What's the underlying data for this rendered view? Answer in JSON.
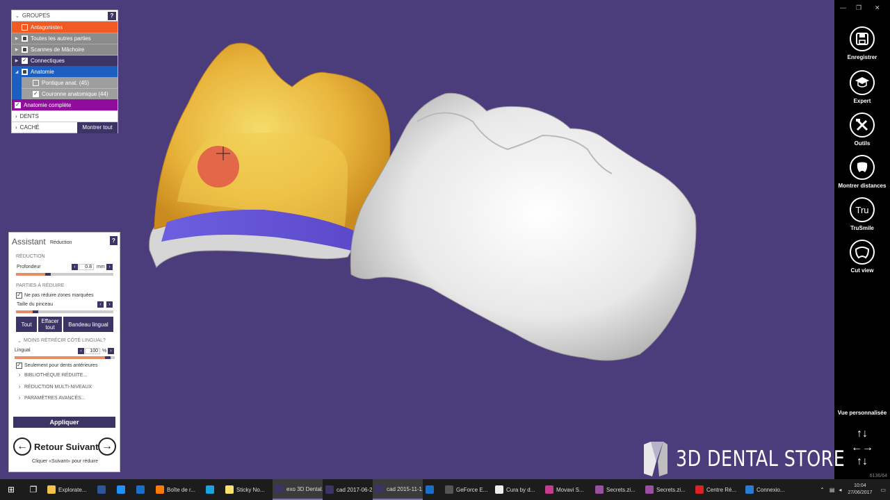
{
  "groups": {
    "header": "GROUPES",
    "help": "?",
    "items": [
      {
        "label": "Antagonistes",
        "color": "#f15a22",
        "checked": "empty"
      },
      {
        "label": "Toutes les autres parties",
        "color": "#8c8c8c",
        "checked": "square"
      },
      {
        "label": "Scannes de Mâchoire",
        "color": "#8c8c8c",
        "checked": "square"
      },
      {
        "label": "Connectiques",
        "color": "#3d3466",
        "checked": "check"
      },
      {
        "label": "Anatomie",
        "color": "#1c5fc0",
        "checked": "square"
      }
    ],
    "subitems": [
      {
        "label": "Pontique anat. (45)",
        "checked": "empty"
      },
      {
        "label": "Couronne anatomique (44)",
        "checked": "check"
      }
    ],
    "highlight": {
      "label": "Anatomie complète",
      "color": "#8f0d9a"
    },
    "dents": "DENTS",
    "cache": "CACHÉ",
    "show_all": "Montrer tout"
  },
  "assistant": {
    "title": "Assistant",
    "subtitle": "Réduction",
    "help": "?",
    "section_reduction": "RÉDUCTION",
    "depth_label": "Profondeur",
    "depth_value": "0.8",
    "depth_unit": "mm",
    "depth_level": 0.33,
    "section_parts": "PARTIES À RÉDUIRE",
    "no_reduce_label": "Ne pas réduire zones marquées",
    "brush_label": "Taille du pinceau",
    "brush_level": 0.2,
    "btn_all": "Tout",
    "btn_clear_1": "Effacer",
    "btn_clear_2": "tout",
    "btn_lingual": "Bandeau lingual",
    "less_shrink": "MOINS RÉTRÉCIR CÔTÉ LINGUAL?",
    "lingual_label": "Lingual",
    "lingual_value": "100",
    "lingual_unit": "%",
    "lingual_level": 0.93,
    "anterior_only": "Seulement pour dents antérieures",
    "opt_library": "BIBLIOTHÈQUE RÉDUITE...",
    "opt_multi": "RÉDUCTION MULTI-NIVEAUX",
    "opt_advanced": "PARAMÈTRES AVANCÉS...",
    "apply": "Appliquer",
    "nav_text": "Retour Suivant",
    "hint": "Cliquer «Suivant» pour réduire"
  },
  "toolbar": {
    "tools": [
      {
        "label": "Enregistrer",
        "icon": "save-icon"
      },
      {
        "label": "Expert",
        "icon": "graduation-cap-icon"
      },
      {
        "label": "Outils",
        "icon": "tools-icon"
      },
      {
        "label": "Montrer distances",
        "icon": "tooth-distance-icon"
      },
      {
        "label": "TruSmile",
        "icon": "trusmile-icon"
      },
      {
        "label": "Cut view",
        "icon": "cut-view-icon"
      }
    ],
    "trusmile_text": "Tru",
    "view_label": "Vue personnalisée",
    "coord": "6136/64"
  },
  "logo": {
    "text": "3D DENTAL STORE"
  },
  "taskbar": {
    "apps": [
      {
        "label": "Explorate...",
        "color": "#f2c34b"
      },
      {
        "label": "",
        "color": "#2b579a"
      },
      {
        "label": "",
        "color": "#1e90ff"
      },
      {
        "label": "",
        "color": "#1a6fc9"
      },
      {
        "label": "Boîte de r...",
        "color": "#ff7a00"
      },
      {
        "label": "",
        "color": "#1aa3e0"
      },
      {
        "label": "Sticky No...",
        "color": "#f7e36b"
      },
      {
        "label": "exo 3D Dental...",
        "color": "#3d3466",
        "active": true
      },
      {
        "label": "cad 2017-06-2...",
        "color": "#3d3466"
      },
      {
        "label": "cad 2015-11-1...",
        "color": "#3d3466",
        "active": true
      },
      {
        "label": "",
        "color": "#1a6fc9"
      },
      {
        "label": "GeForce E...",
        "color": "#555555"
      },
      {
        "label": "Cura by d...",
        "color": "#eeeeee"
      },
      {
        "label": "Movavi S...",
        "color": "#c43c8b"
      },
      {
        "label": "Secrets.zi...",
        "color": "#9b4fa0"
      },
      {
        "label": "Secrets.zi...",
        "color": "#9b4fa0"
      },
      {
        "label": "Centre Ré...",
        "color": "#dd2222"
      },
      {
        "label": "Connexio...",
        "color": "#2a7bd4"
      }
    ],
    "time": "10:04",
    "date": "27/06/2017"
  }
}
